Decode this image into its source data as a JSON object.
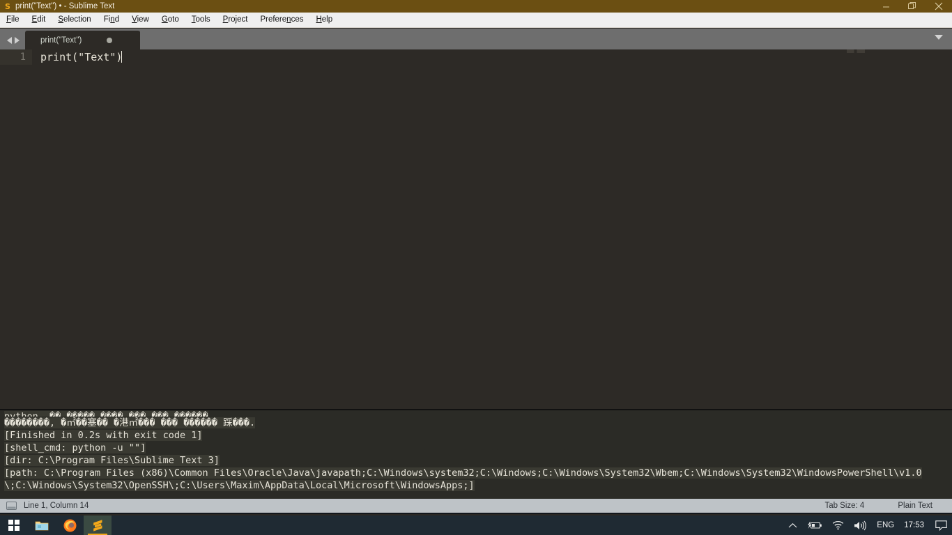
{
  "window": {
    "title": "print(\"Text\") • - Sublime Text",
    "logo_glyph": "S",
    "controls": [
      {
        "name": "minimize",
        "label": "—"
      },
      {
        "name": "restore",
        "label": "❐"
      },
      {
        "name": "close",
        "label": "✕"
      }
    ],
    "titlebar_color": "#6b4f12"
  },
  "menubar": {
    "items": [
      {
        "pre": "",
        "mn": "F",
        "post": "ile"
      },
      {
        "pre": "",
        "mn": "E",
        "post": "dit"
      },
      {
        "pre": "",
        "mn": "S",
        "post": "election"
      },
      {
        "pre": "Fi",
        "mn": "n",
        "post": "d"
      },
      {
        "pre": "",
        "mn": "V",
        "post": "iew"
      },
      {
        "pre": "",
        "mn": "G",
        "post": "oto"
      },
      {
        "pre": "",
        "mn": "T",
        "post": "ools"
      },
      {
        "pre": "",
        "mn": "P",
        "post": "roject"
      },
      {
        "pre": "Prefere",
        "mn": "n",
        "post": "ces"
      },
      {
        "pre": "",
        "mn": "H",
        "post": "elp"
      }
    ]
  },
  "tabbar": {
    "nav_prev": "previous-tab",
    "nav_next": "next-tab",
    "tabs": [
      {
        "label": "print(\"Text\")",
        "dirty": true,
        "active": true
      }
    ],
    "overflow_menu": "tab-overflow"
  },
  "editor": {
    "lines": [
      {
        "number": "1",
        "text": "print(\"Text\")"
      }
    ],
    "background": "#2d2a26",
    "gutter_background": "#35322c"
  },
  "console": {
    "lines": [
      {
        "text": "python  �� ����� ���� ��� ��� ������",
        "highlight": true,
        "clipped": true
      },
      {
        "text": "��������, �㎡��塞�� �港㎡��� ��� ������ 踩���.",
        "highlight": true,
        "clipped": false
      },
      {
        "text": "[Finished in 0.2s with exit code 1]",
        "highlight": true,
        "clipped": false
      },
      {
        "text": "[shell_cmd: python -u \"\"]",
        "highlight": true,
        "clipped": false
      },
      {
        "text": "[dir: C:\\Program Files\\Sublime Text 3]",
        "highlight": true,
        "clipped": false
      },
      {
        "text": "[path: C:\\Program Files (x86)\\Common Files\\Oracle\\Java\\javapath;C:\\Windows\\system32;C:\\Windows;C:\\Windows\\System32\\Wbem;C:\\Windows\\System32\\WindowsPowerShell\\v1.0",
        "highlight": true,
        "clipped": false
      },
      {
        "text": "\\;C:\\Windows\\System32\\OpenSSH\\;C:\\Users\\Maxim\\AppData\\Local\\Microsoft\\WindowsApps;]",
        "highlight": true,
        "clipped": false
      }
    ]
  },
  "statusbar": {
    "sidebar_toggle": "sidebar-toggle",
    "cursor_position": "Line 1, Column 14",
    "tab_size": "Tab Size: 4",
    "syntax": "Plain Text"
  },
  "taskbar": {
    "start": "start-button",
    "apps": [
      {
        "name": "file-explorer",
        "active": false
      },
      {
        "name": "firefox",
        "active": false
      },
      {
        "name": "sublime-text",
        "active": true
      }
    ],
    "tray": {
      "show_hidden": "show-hidden-icons",
      "battery": "battery-charging-icon",
      "network": "wifi-icon",
      "volume": "speaker-icon",
      "language": "ENG",
      "time": "17:53",
      "notifications": "action-center-icon"
    }
  }
}
